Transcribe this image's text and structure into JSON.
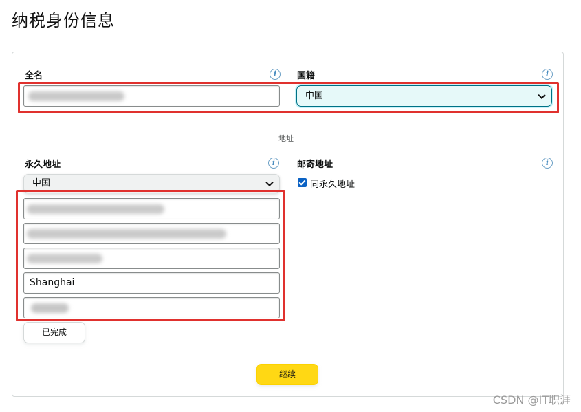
{
  "page": {
    "title": "纳税身份信息"
  },
  "full_name": {
    "label": "全名",
    "info_icon": "info-icon",
    "value_hidden": true
  },
  "nationality": {
    "label": "国籍",
    "info_icon": "info-icon",
    "selected": "中国"
  },
  "address_section": {
    "divider": "地址"
  },
  "permanent_address": {
    "label": "永久地址",
    "info_icon": "info-icon",
    "country": "中国",
    "lines": [
      {
        "value": "",
        "blurred": true
      },
      {
        "value": "",
        "blurred": true
      },
      {
        "value": "",
        "blurred": true
      },
      {
        "value": "Shanghai",
        "blurred": false
      },
      {
        "value": "",
        "blurred": true
      }
    ],
    "done_button": "已完成"
  },
  "mailing_address": {
    "label": "邮寄地址",
    "info_icon": "info-icon",
    "same_as_permanent": {
      "checked": true,
      "label": "同永久地址"
    }
  },
  "actions": {
    "continue": "继续"
  },
  "watermark": "CSDN @IT职涯",
  "colors": {
    "primary_button": "#ffd814",
    "focus_border": "#007185",
    "highlight_box": "#e0312e",
    "checkbox": "#0b62c4"
  }
}
